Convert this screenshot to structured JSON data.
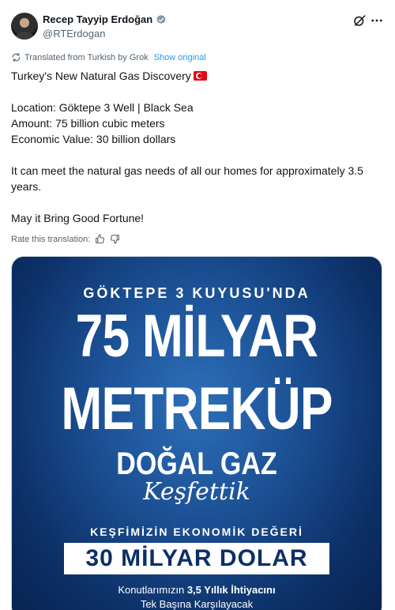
{
  "author": {
    "name": "Recep Tayyip Erdoğan",
    "handle": "@RTErdogan"
  },
  "translation": {
    "note": "Translated from Turkish by Grok",
    "show_original": "Show original",
    "rate_label": "Rate this translation:"
  },
  "tweet": {
    "title": "Turkey's New Natural Gas Discovery",
    "location": "Location: Göktepe 3 Well | Black Sea",
    "amount": "Amount: 75 billion cubic meters",
    "economic_value": "Economic Value: 30 billion dollars",
    "needs": "It can meet the natural gas needs of all our homes for approximately 3.5 years.",
    "closing": "May it Bring Good Fortune!"
  },
  "media": {
    "top_line": "GÖKTEPE 3 KUYUSU'NDA",
    "big_line1": "75 MİLYAR",
    "big_line2": "METREKÜP",
    "gas_line": "DOĞAL GAZ",
    "script_line": "Keşfettik",
    "value_label": "KEŞFİMİZİN EKONOMİK DEĞERİ",
    "value_box": "30 MİLYAR DOLAR",
    "line1_pre": "Konutlarımızın ",
    "line1_bold": "3,5 Yıllık İhtiyacını",
    "line2": "Tek Başına Karşılayacak"
  },
  "colors": {
    "link": "#1d9bf0",
    "secondary_text": "#536471",
    "media_blue": "#1b4f93"
  },
  "icons": [
    "verified-badge-icon",
    "grok-icon",
    "more-icon",
    "translate-icon",
    "thumbs-up-icon",
    "thumbs-down-icon"
  ]
}
